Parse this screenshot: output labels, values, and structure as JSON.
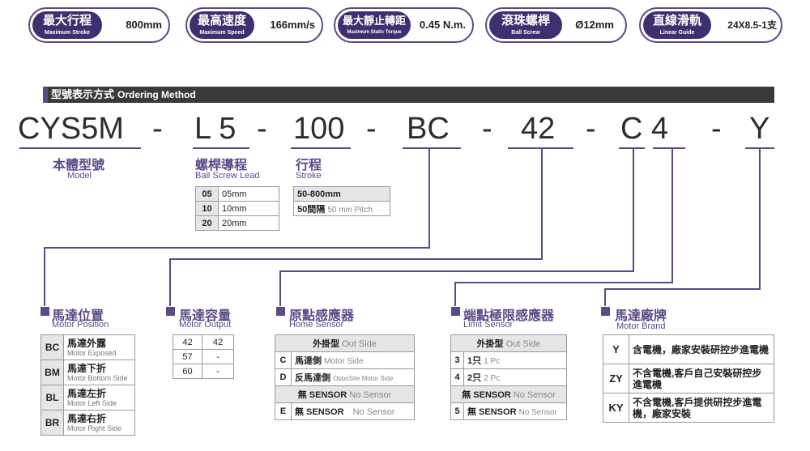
{
  "specs": [
    {
      "zh": "最大行程",
      "en": "Maximum Stroke",
      "value": "800mm"
    },
    {
      "zh": "最高速度",
      "en": "Maximum Speed",
      "value": "166mm/s"
    },
    {
      "zh": "最大靜止轉距",
      "en": "Maximum Static Torque",
      "value": "0.45 N.m."
    },
    {
      "zh": "滾珠螺桿",
      "en": "Ball Screw",
      "value": "Ø12mm"
    },
    {
      "zh": "直線滑軌",
      "en": "Linear Guide",
      "value": "24X8.5-1支"
    }
  ],
  "header": {
    "zh": "型號表示方式",
    "en": "Ordering Method"
  },
  "code": {
    "model": "CYS5M",
    "d1": "-",
    "lead": "L 5",
    "d2": "-",
    "stroke": "100",
    "d3": "-",
    "sensor": "BC",
    "d4": "-",
    "output": "42",
    "d5": "-",
    "limit": "C 4",
    "d6": "-",
    "brand": "Y"
  },
  "model": {
    "zh": "本體型號",
    "en": "Model"
  },
  "lead": {
    "zh": "螺桿導程",
    "en": "Ball Screw Lead",
    "rows": [
      [
        "05",
        "05mm"
      ],
      [
        "10",
        "10mm"
      ],
      [
        "20",
        "20mm"
      ]
    ]
  },
  "stroke": {
    "zh": "行程",
    "en": "Stroke",
    "row1": "50-800mm",
    "row2_zh": "50間隔",
    "row2_en": "50 mm Pitch"
  },
  "motor_position": {
    "zh": "馬達位置",
    "en": "Motor Position",
    "rows": [
      {
        "k": "BC",
        "zh": "馬達外露",
        "en": "Motor Exposed"
      },
      {
        "k": "BM",
        "zh": "馬達下折",
        "en": "Motor Bottom Side"
      },
      {
        "k": "BL",
        "zh": "馬達左折",
        "en": "Motor Left Side"
      },
      {
        "k": "BR",
        "zh": "馬達右折",
        "en": "Motor Right Side"
      }
    ]
  },
  "motor_output": {
    "zh": "馬達容量",
    "en": "Motor Output",
    "rows": [
      [
        "42",
        "42"
      ],
      [
        "57",
        "-"
      ],
      [
        "60",
        "-"
      ]
    ]
  },
  "home_sensor": {
    "zh": "原點感應器",
    "en": "Home Sensor",
    "head_zh": "外掛型",
    "head_en": "Out Side",
    "rows": [
      {
        "k": "C",
        "zh": "馬達側",
        "en": "Motor Side"
      },
      {
        "k": "D",
        "zh": "反馬達側",
        "en": "OppoSite Motor Side"
      },
      {
        "k": "",
        "zh": "無 SENSOR",
        "en": "No Sensor"
      },
      {
        "k": "E",
        "zh": "無 SENSOR",
        "en": "No Sensor"
      }
    ]
  },
  "limit_sensor": {
    "zh": "端點極限感應器",
    "en": "Limit Sensor",
    "head_zh": "外掛型",
    "head_en": "Out Side",
    "rows": [
      {
        "k": "3",
        "zh": "1只",
        "en": "1 Pc"
      },
      {
        "k": "4",
        "zh": "2只",
        "en": "2 Pc"
      },
      {
        "k": "",
        "zh": "無 SENSOR",
        "en": "No Sensor"
      },
      {
        "k": "5",
        "zh": "無 SENSOR",
        "en": "No Sensor"
      }
    ]
  },
  "motor_brand": {
    "zh": "馬達廠牌",
    "en": "Motor Brand",
    "rows": [
      {
        "k": "Y",
        "zh": "含電機，廠家安裝研控步進電機"
      },
      {
        "k": "ZY",
        "zh": "不含電機,客戶自己安裝研控步進電機"
      },
      {
        "k": "KY",
        "zh": "不含電機,客戶提供研控步進電機，廠家安裝"
      }
    ]
  }
}
